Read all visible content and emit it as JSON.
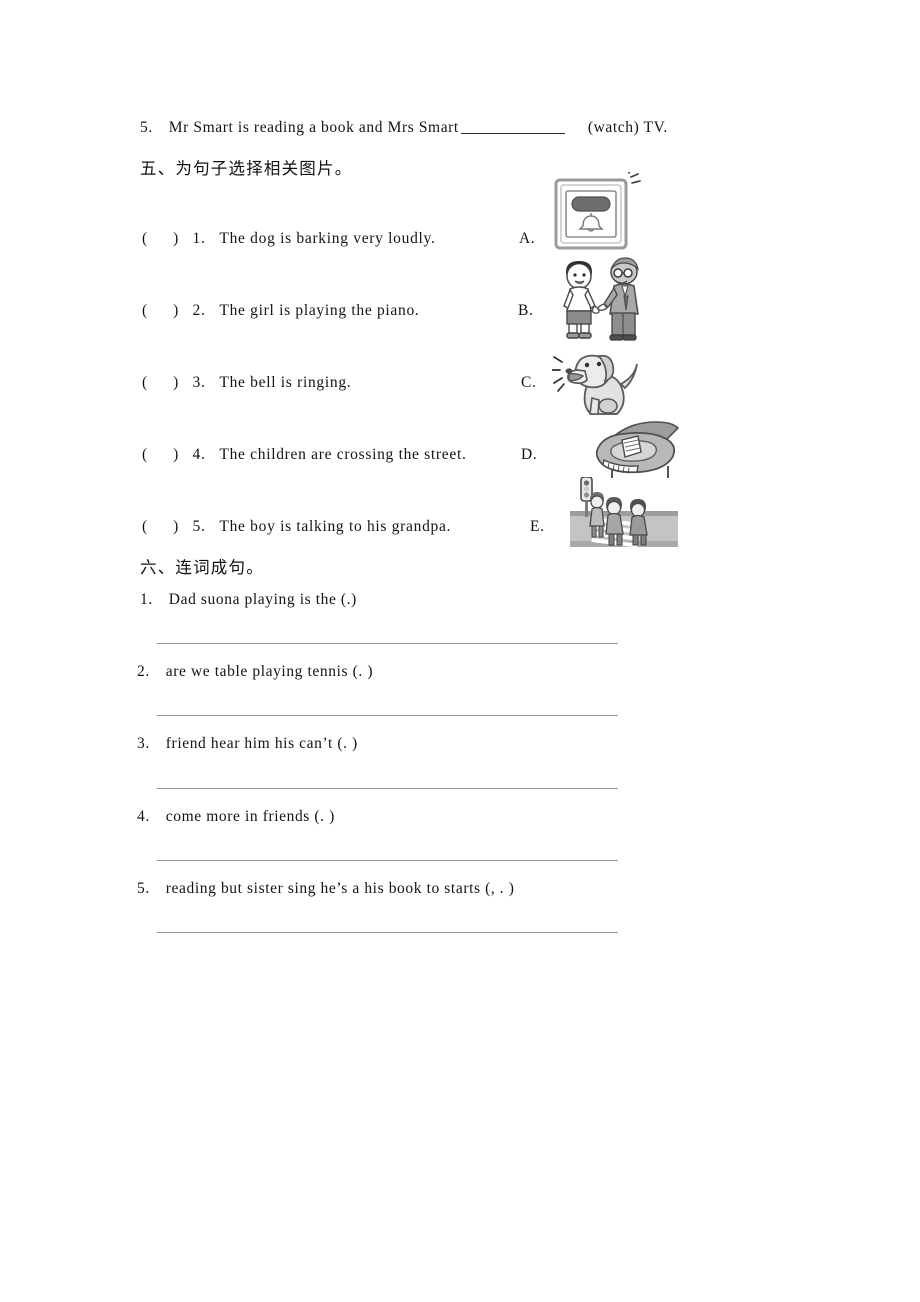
{
  "document": {
    "type": "english-worksheet",
    "language": "zh-CN + en"
  },
  "carryover_item": {
    "number": "5.",
    "text_before": "Mr Smart is reading a book and Mrs Smart",
    "text_after": "(watch) TV."
  },
  "section_five": {
    "heading": "五、为句子选择相关图片。",
    "items": [
      {
        "marker": "(",
        "marker_close": ")",
        "number": "1.",
        "sentence": "The dog is barking very loudly.",
        "option_letter": "A."
      },
      {
        "marker": "(",
        "marker_close": ")",
        "number": "2.",
        "sentence": "The girl is playing the piano.",
        "option_letter": "B."
      },
      {
        "marker": "(",
        "marker_close": ")",
        "number": "3.",
        "sentence": "The bell is ringing.",
        "option_letter": "C."
      },
      {
        "marker": "(",
        "marker_close": ")",
        "number": "4.",
        "sentence": "The children are crossing the street.",
        "option_letter": "D."
      },
      {
        "marker": "(",
        "marker_close": ")",
        "number": "5.",
        "sentence": "The boy is talking to his grandpa.",
        "option_letter": "E."
      }
    ],
    "pictures": [
      {
        "letter": "A",
        "name": "doorbell-panel-illustration",
        "description": "square doorbell panel with bell symbol ringing"
      },
      {
        "letter": "B",
        "name": "boy-and-grandpa-illustration",
        "description": "boy talking to an elderly man with glasses"
      },
      {
        "letter": "C",
        "name": "barking-dog-illustration",
        "description": "dog sitting and barking loudly"
      },
      {
        "letter": "D",
        "name": "grand-piano-illustration",
        "description": "grand piano with open lid and sheet music"
      },
      {
        "letter": "E",
        "name": "children-crossing-street-illustration",
        "description": "three children crossing a zebra crossing beside a traffic light"
      }
    ]
  },
  "section_six": {
    "heading": "六、连词成句。",
    "items": [
      {
        "number": "1.",
        "words": "Dad   suona   playing   is   the (.)"
      },
      {
        "number": "2.",
        "words": "are  we   table  playing   tennis (. )"
      },
      {
        "number": "3.",
        "words": "friend   hear   him   his   can’t (. )"
      },
      {
        "number": "4.",
        "words": "come   more   in   friends (. )"
      },
      {
        "number": "5.",
        "words": "reading   but   sister   sing   he’s   a   his   book   to   starts (, . )"
      }
    ]
  },
  "colors": {
    "text": "#141414",
    "answer_line": "#9a9a9a",
    "blank_line": "#2a2a2a",
    "page_background": "#ffffff"
  }
}
